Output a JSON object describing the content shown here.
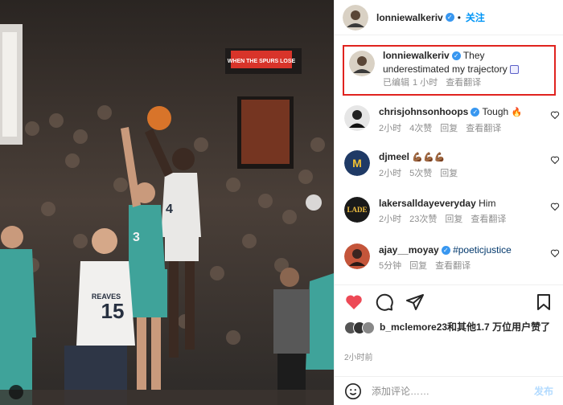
{
  "header": {
    "username": "lonniewalkeriv",
    "separator": "•",
    "follow_label": "关注",
    "more": "···"
  },
  "caption": {
    "username": "lonniewalkeriv",
    "text": "They underestimated my trajectory",
    "edited": "已编辑",
    "time": "1 小时",
    "translate": "查看翻译"
  },
  "comments": [
    {
      "username": "chrisjohnsonhoops",
      "verified": true,
      "text": "Tough",
      "emoji": "🔥",
      "time": "2小时",
      "likes": "4次赞",
      "reply": "回复",
      "translate": "查看翻译"
    },
    {
      "username": "djmeel",
      "verified": false,
      "text": "",
      "emoji": "💪🏾💪🏾💪🏾",
      "time": "2小时",
      "likes": "5次赞",
      "reply": "回复",
      "translate": ""
    },
    {
      "username": "lakersalldayeveryday",
      "verified": false,
      "text": "Him",
      "emoji": "",
      "time": "2小时",
      "likes": "23次赞",
      "reply": "回复",
      "translate": "查看翻译"
    },
    {
      "username": "ajay__moyay",
      "verified": true,
      "text": "#poeticjustice",
      "emoji": "",
      "time": "5分钟",
      "likes": "",
      "reply": "回复",
      "translate": "查看翻译"
    }
  ],
  "likes": {
    "text": "b_mclemore23和其他1.7 万位用户赞了"
  },
  "post_time": "2小时前",
  "add_comment": {
    "placeholder": "添加评论……",
    "publish": "发布"
  },
  "photo": {
    "sign_text": "WHEN THE SPURS LOSE",
    "jersey_front": "15",
    "jersey_front_name": "REAVES",
    "jersey_green": "3",
    "jersey_white": "4"
  },
  "colors": {
    "accent": "#0095f6",
    "verified": "#3897f0",
    "heart": "#ed4956",
    "highlight_border": "#e0231f"
  }
}
